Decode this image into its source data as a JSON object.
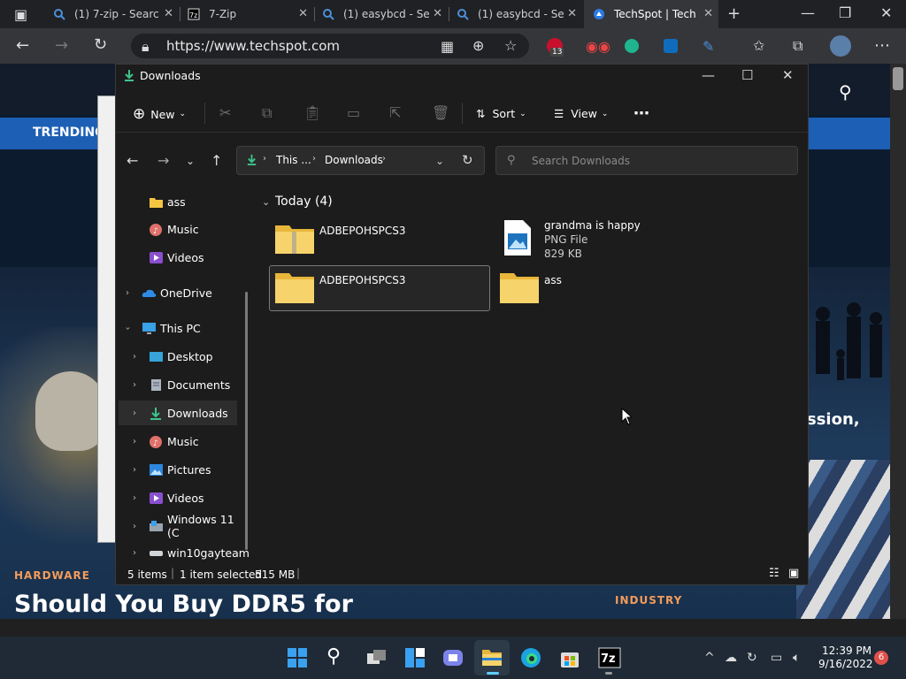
{
  "browser": {
    "tabs": [
      {
        "title": "(1) 7-zip - Searc",
        "icon": "search-icon"
      },
      {
        "title": "7-Zip",
        "icon": "7zip-icon"
      },
      {
        "title": "(1) easybcd - Se",
        "icon": "search-icon"
      },
      {
        "title": "(1) easybcd - Se",
        "icon": "search-icon"
      },
      {
        "title": "TechSpot | Tech",
        "icon": "techspot-icon"
      }
    ],
    "url": "https://www.techspot.com",
    "ext_badge": "13"
  },
  "website": {
    "nav_label": "TRENDING",
    "section_hardware": "HARDWARE",
    "headline": "Should You Buy DDR5 for",
    "section_industry": "INDUSTRY",
    "partial_text": "ssion,"
  },
  "explorer": {
    "title": "Downloads",
    "commands": {
      "new": "New",
      "sort": "Sort",
      "view": "View"
    },
    "address": {
      "crumb1": "This ...",
      "crumb2": "Downloads"
    },
    "search_placeholder": "Search Downloads",
    "nav_items": [
      {
        "label": "ass",
        "icon": "folder-icon"
      },
      {
        "label": "Music",
        "icon": "music-icon"
      },
      {
        "label": "Videos",
        "icon": "videos-icon"
      },
      {
        "label": "OneDrive",
        "icon": "onedrive-icon"
      },
      {
        "label": "This PC",
        "icon": "pc-icon"
      },
      {
        "label": "Desktop",
        "icon": "desktop-icon"
      },
      {
        "label": "Documents",
        "icon": "documents-icon"
      },
      {
        "label": "Downloads",
        "icon": "downloads-icon"
      },
      {
        "label": "Music",
        "icon": "music-icon"
      },
      {
        "label": "Pictures",
        "icon": "pictures-icon"
      },
      {
        "label": "Videos",
        "icon": "videos-icon"
      },
      {
        "label": "Windows 11 (C",
        "icon": "drive-icon"
      },
      {
        "label": "win10gayteam",
        "icon": "network-drive-icon"
      }
    ],
    "group_header": "Today (4)",
    "files": [
      {
        "name": "ADBEPOHSPCS3",
        "type": "zip"
      },
      {
        "name": "grandma is happy",
        "type_label": "PNG File",
        "size": "829 KB"
      },
      {
        "name": "ADBEPOHSPCS3",
        "type": "folder"
      },
      {
        "name": "ass",
        "type": "folder"
      }
    ],
    "status": {
      "count": "5 items",
      "selected": "1 item selected",
      "size": "515 MB"
    }
  },
  "taskbar": {
    "time": "12:39 PM",
    "date": "9/16/2022",
    "notifications": "6"
  }
}
